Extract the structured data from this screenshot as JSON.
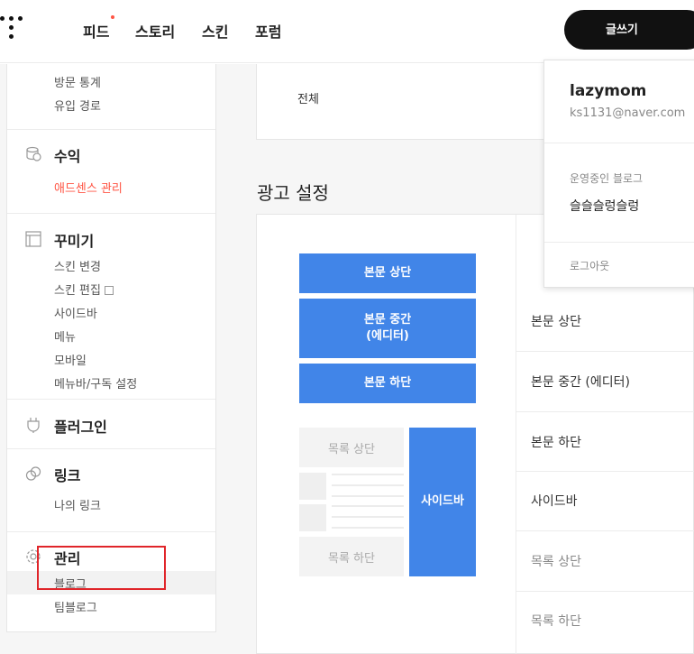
{
  "header": {
    "nav": [
      "피드",
      "스토리",
      "스킨",
      "포럼"
    ],
    "write_label": "글쓰기"
  },
  "sidebar": {
    "stats_items": [
      "방문 통계",
      "유입 경로"
    ],
    "revenue": {
      "title": "수익",
      "items": [
        "애드센스 관리"
      ]
    },
    "design": {
      "title": "꾸미기",
      "items": [
        "스킨 변경",
        "스킨 편집",
        "사이드바",
        "메뉴",
        "모바일",
        "메뉴바/구독 설정"
      ]
    },
    "plugin": {
      "title": "플러그인"
    },
    "link": {
      "title": "링크",
      "items": [
        "나의 링크"
      ]
    },
    "manage": {
      "title": "관리",
      "items": [
        "블로그",
        "팀블로그"
      ]
    }
  },
  "main": {
    "top_card_label": "전체",
    "section_title": "광고 설정",
    "preview": {
      "body_top": "본문 상단",
      "body_mid_line1": "본문 중간",
      "body_mid_line2": "(에디터)",
      "body_bottom": "본문 하단",
      "list_top": "목록 상단",
      "list_bottom": "목록 하단",
      "sidebar": "사이드바"
    },
    "ad_rows": [
      {
        "label": "본문 상단",
        "muted": false
      },
      {
        "label": "본문 중간 (에디터)",
        "muted": false
      },
      {
        "label": "본문 하단",
        "muted": false
      },
      {
        "label": "사이드바",
        "muted": false
      },
      {
        "label": "목록 상단",
        "muted": true
      },
      {
        "label": "목록 하단",
        "muted": true
      }
    ]
  },
  "profile": {
    "name": "lazymom",
    "email": "ks1131@naver.com",
    "blog_label": "운영중인 블로그",
    "blog_name": "슬슬슬렁슬렁",
    "logout_label": "로그아웃"
  },
  "colors": {
    "accent_red": "#ff5544",
    "ad_blue": "#4185e8",
    "highlight_red": "#e0252a"
  }
}
